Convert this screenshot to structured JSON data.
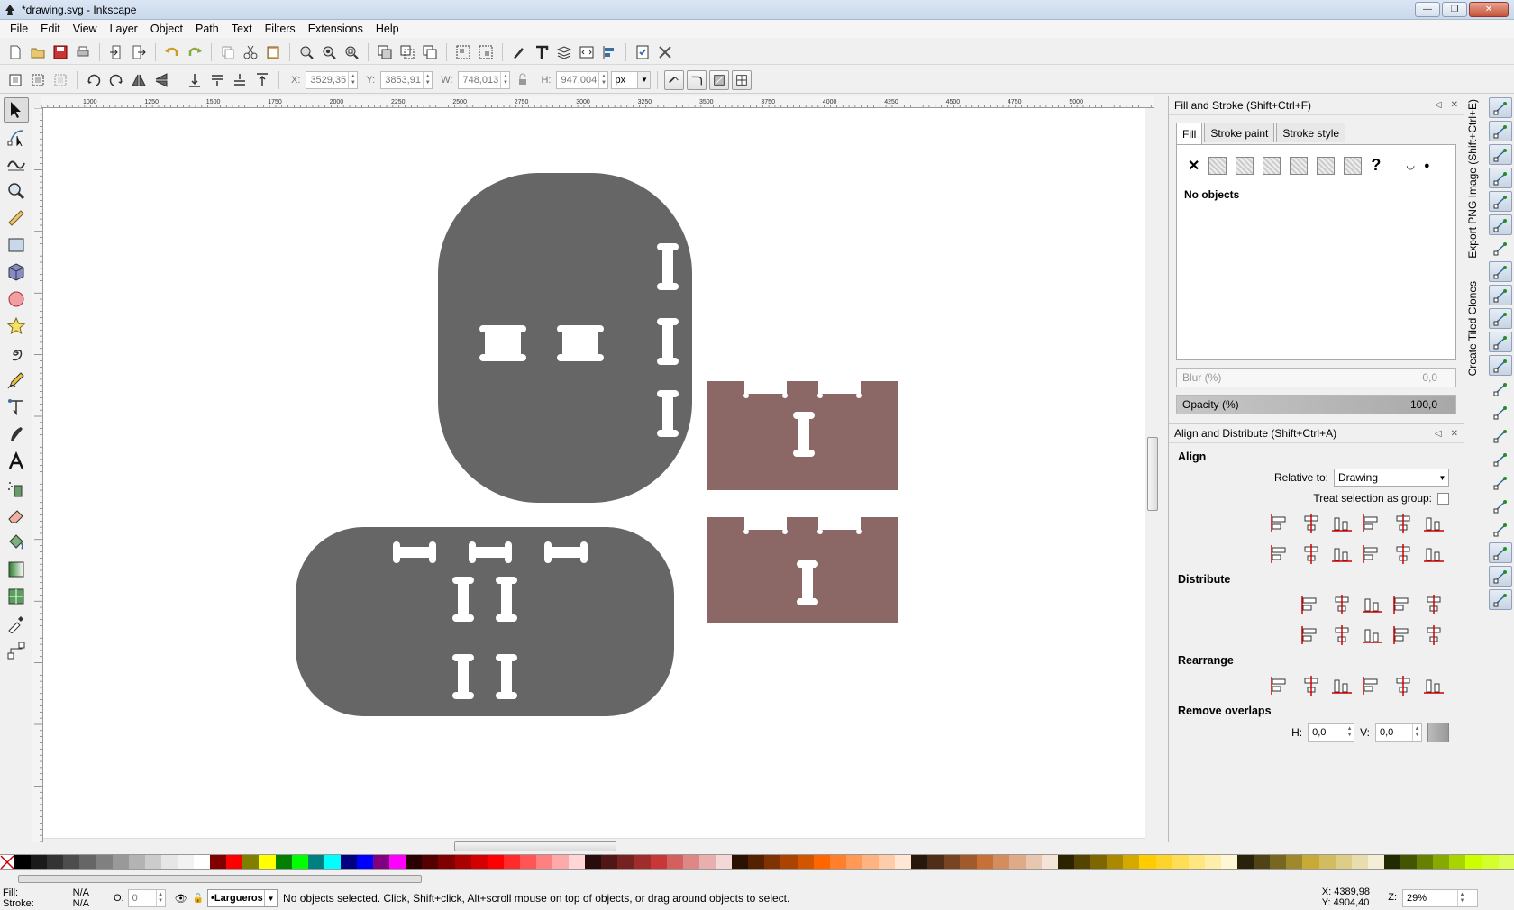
{
  "window": {
    "title": "*drawing.svg - Inkscape",
    "min": "—",
    "max": "❐",
    "close": "✕"
  },
  "menu": [
    "File",
    "Edit",
    "View",
    "Layer",
    "Object",
    "Path",
    "Text",
    "Filters",
    "Extensions",
    "Help"
  ],
  "toolbar2": {
    "x_label": "X:",
    "x_value": "3529,35",
    "y_label": "Y:",
    "y_value": "3853,91",
    "w_label": "W:",
    "w_value": "748,013",
    "h_label": "H:",
    "h_value": "947,004",
    "unit": "px"
  },
  "ruler_labels": [
    "1000",
    "1250",
    "1500",
    "1750",
    "2000",
    "2250",
    "2500",
    "2750",
    "3000",
    "3250",
    "3500",
    "3750",
    "4000",
    "4250",
    "4500",
    "4750",
    "5000"
  ],
  "fill_stroke": {
    "title": "Fill and Stroke (Shift+Ctrl+F)",
    "tabs": [
      "Fill",
      "Stroke paint",
      "Stroke style"
    ],
    "status": "No objects",
    "unknown_glyph": "?",
    "blur_label": "Blur (%)",
    "blur_value": "0,0",
    "opacity_label": "Opacity (%)",
    "opacity_value": "100,0"
  },
  "align": {
    "title": "Align and Distribute (Shift+Ctrl+A)",
    "align_heading": "Align",
    "relative_label": "Relative to:",
    "relative_value": "Drawing",
    "treat_group_label": "Treat selection as group:",
    "distribute_heading": "Distribute",
    "rearrange_heading": "Rearrange",
    "remove_overlaps_heading": "Remove overlaps",
    "h_label": "H:",
    "h_value": "0,0",
    "v_label": "V:",
    "v_value": "0,0"
  },
  "side_tabs": {
    "export": "Export PNG Image (Shift+Ctrl+E)",
    "tiled": "Create Tiled Clones"
  },
  "status": {
    "fill_label": "Fill:",
    "fill_value": "N/A",
    "stroke_label": "Stroke:",
    "stroke_value": "N/A",
    "opacity_label": "O:",
    "opacity_value": "0",
    "layer": "•Largueros",
    "message": "No objects selected. Click, Shift+click, Alt+scroll mouse on top of objects, or drag around objects to select.",
    "x": "X: 4389,98",
    "y": "Y: 4904,40",
    "zoom_label": "Z:",
    "zoom_value": "29%"
  },
  "colors": {
    "gray_shape": "#666666",
    "brown_shape": "#8b6866",
    "accent": "#3a6ea5"
  },
  "palette": [
    "#000000",
    "#1a1a1a",
    "#333333",
    "#4d4d4d",
    "#666666",
    "#808080",
    "#999999",
    "#b3b3b3",
    "#cccccc",
    "#e6e6e6",
    "#f2f2f2",
    "#ffffff",
    "#800000",
    "#ff0000",
    "#808000",
    "#ffff00",
    "#008000",
    "#00ff00",
    "#008080",
    "#00ffff",
    "#000080",
    "#0000ff",
    "#800080",
    "#ff00ff",
    "#2b0000",
    "#550000",
    "#800000",
    "#aa0000",
    "#d40000",
    "#ff0000",
    "#ff2a2a",
    "#ff5555",
    "#ff8080",
    "#ffaaaa",
    "#ffd5d5",
    "#280b0b",
    "#501616",
    "#782121",
    "#a02c2c",
    "#c83737",
    "#d35f5f",
    "#de8787",
    "#e9afaf",
    "#f4d7d7",
    "#2b1100",
    "#552200",
    "#803300",
    "#aa4400",
    "#d45500",
    "#ff6600",
    "#ff7f2a",
    "#ff9955",
    "#ffb380",
    "#ffccaa",
    "#ffe6d5",
    "#28170b",
    "#502d16",
    "#784421",
    "#a05a2c",
    "#c87137",
    "#d38d5f",
    "#deaa87",
    "#e9c6af",
    "#f4e3d7",
    "#2b2200",
    "#554400",
    "#806600",
    "#aa8800",
    "#d4aa00",
    "#ffcc00",
    "#ffd42a",
    "#ffdd55",
    "#ffe680",
    "#ffeeaa",
    "#fff6d5",
    "#28220b",
    "#504416",
    "#786721",
    "#a0892c",
    "#c8ab37",
    "#d3bc5f",
    "#decd87",
    "#e9ddaf",
    "#f4eed7",
    "#222b00",
    "#445500",
    "#668000",
    "#88aa00",
    "#aad400",
    "#ccff00",
    "#d4ff2a",
    "#ddff55"
  ]
}
